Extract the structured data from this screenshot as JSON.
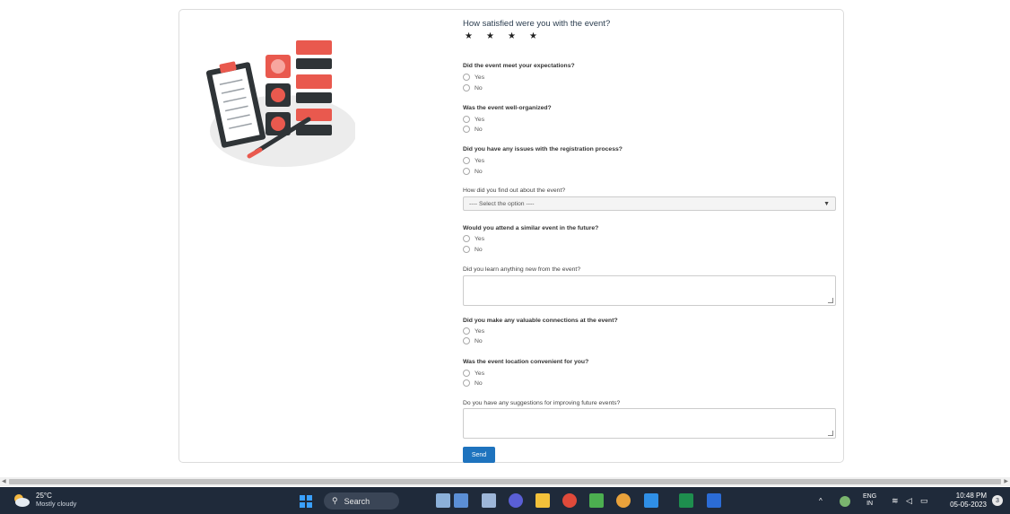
{
  "form": {
    "rating": {
      "question": "How satisfied were you with the event?",
      "stars": [
        "★",
        "★",
        "★",
        "★"
      ]
    },
    "q1": {
      "label": "Did the event meet your expectations?",
      "options": [
        "Yes",
        "No"
      ]
    },
    "q2": {
      "label": "Was the event well-organized?",
      "options": [
        "Yes",
        "No"
      ]
    },
    "q3": {
      "label": "Did you have any issues with the registration process?",
      "options": [
        "Yes",
        "No"
      ]
    },
    "find_out": {
      "label": "How did you find out about the event?",
      "selected": "---- Select the option ----",
      "caret": "▼"
    },
    "q4": {
      "label": "Would you attend a similar event in the future?",
      "options": [
        "Yes",
        "No"
      ]
    },
    "learn": {
      "label": "Did you learn anything new from the event?"
    },
    "q5": {
      "label": "Did you make any valuable connections at the event?",
      "options": [
        "Yes",
        "No"
      ]
    },
    "q6": {
      "label": "Was the event location convenient for you?",
      "options": [
        "Yes",
        "No"
      ]
    },
    "suggestions": {
      "label": "Do you have any suggestions for improving future events?"
    },
    "send_label": "Send"
  },
  "taskbar": {
    "weather_temp": "25°C",
    "weather_cond": "Mostly cloudy",
    "search_label": "Search",
    "search_icon": "⚲",
    "tray_chevron": "^",
    "lang_top": "ENG",
    "lang_bottom": "IN",
    "time": "10:48 PM",
    "date": "05-05-2023",
    "notif_count": "3"
  },
  "colors": {
    "accent": "#1e73be",
    "taskbar": "#1f2a3a",
    "illustration": "#e9594e"
  }
}
